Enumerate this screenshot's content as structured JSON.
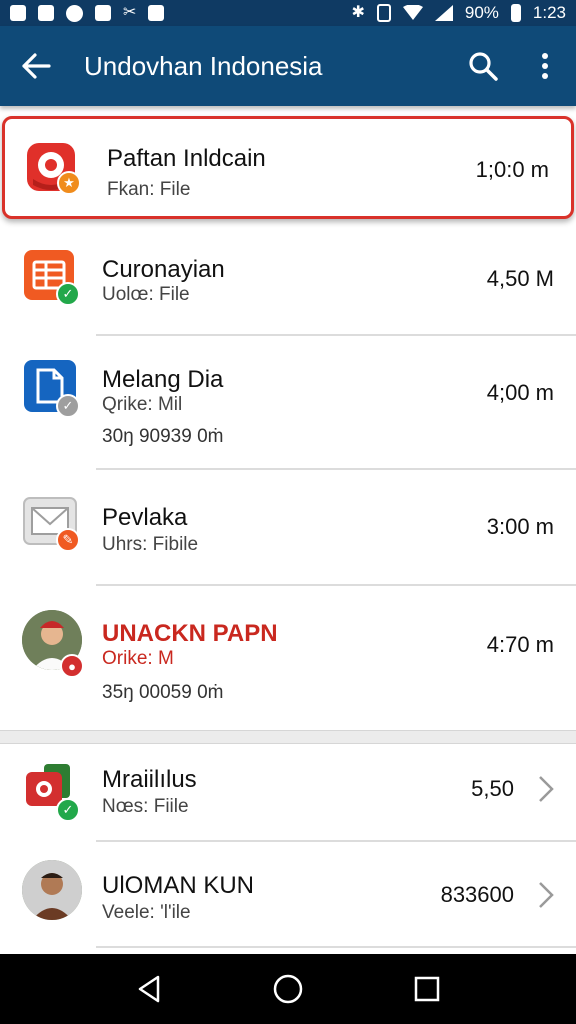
{
  "status_bar": {
    "battery": "90%",
    "time": "1:23"
  },
  "app_bar": {
    "title": "Undovhan Indonesia",
    "back_icon": "arrow-left-icon",
    "search_icon": "search-icon",
    "menu_icon": "more-vert-icon"
  },
  "items": [
    {
      "title": "Paftan Inldcain",
      "subtitle": "Fkan: File",
      "meta": "1;0:0 m",
      "extra": "",
      "icon": "map-pin-icon",
      "badge": "star-badge-icon"
    },
    {
      "title": "Curonayian",
      "subtitle": "Uolœ: File",
      "meta": "4,50 M",
      "extra": "",
      "icon": "spreadsheet-icon",
      "badge": "check-badge-icon"
    },
    {
      "title": "Melang Dia",
      "subtitle": "Qrike: Mil",
      "meta": "4;00 m",
      "extra": "30ŋ 90939 0ṁ",
      "icon": "document-icon",
      "badge": "check-gray-badge-icon"
    },
    {
      "title": "Pevlaka",
      "subtitle": "Uhrs: Fibile",
      "meta": "3:00 m",
      "extra": "",
      "icon": "mail-icon",
      "badge": "edit-badge-icon"
    },
    {
      "title": "UNACKN PAPN",
      "subtitle": "Orike: M",
      "meta": "4:70 m",
      "extra": "35ŋ 00059 0ṁ",
      "icon": "person-photo-avatar",
      "badge": "record-badge-icon"
    },
    {
      "title": "Mraiilılus",
      "subtitle": "Nœs: Fiile",
      "meta": "5,50",
      "extra": "",
      "icon": "camera-icon",
      "badge": "check-badge-icon"
    },
    {
      "title": "UlOMAN KUN",
      "subtitle": "Veele: 'l'ile",
      "meta": "833600",
      "extra": "",
      "icon": "person-photo-avatar-2",
      "badge": ""
    }
  ],
  "nav": {
    "back": "nav-back-icon",
    "home": "nav-home-icon",
    "recents": "nav-recents-icon"
  },
  "colors": {
    "app_bar": "#0f4a78",
    "status_bar": "#0f3a63",
    "highlight": "#d9322a",
    "accent_red": "#c9281f"
  }
}
